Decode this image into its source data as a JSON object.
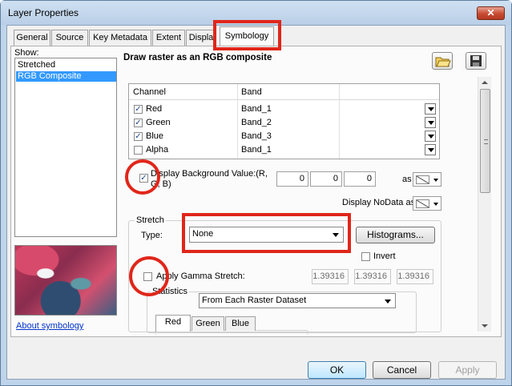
{
  "window": {
    "title": "Layer Properties",
    "close_glyph": "✕"
  },
  "tabs": [
    {
      "label": "General"
    },
    {
      "label": "Source"
    },
    {
      "label": "Key Metadata"
    },
    {
      "label": "Extent"
    },
    {
      "label": "Displa"
    },
    {
      "label": "Symbology"
    }
  ],
  "sidebar": {
    "show_label": "Show:",
    "items": [
      {
        "label": "Stretched"
      },
      {
        "label": "RGB Composite"
      }
    ],
    "selected_index": 1,
    "about_link": "About symbology"
  },
  "main": {
    "heading": "Draw raster as an RGB composite",
    "toolbar_icons": [
      "open-folder-icon",
      "save-icon"
    ],
    "channel_table": {
      "headers": [
        "Channel",
        "Band"
      ],
      "rows": [
        {
          "channel": "Red",
          "band": "Band_1",
          "checked": true
        },
        {
          "channel": "Green",
          "band": "Band_2",
          "checked": true
        },
        {
          "channel": "Blue",
          "band": "Band_3",
          "checked": true
        },
        {
          "channel": "Alpha",
          "band": "Band_1",
          "checked": false
        }
      ]
    },
    "background": {
      "label": "Display Background Value:(R, G, B)",
      "checked": true,
      "r": "0",
      "g": "0",
      "b": "0",
      "as_label": "as"
    },
    "nodata": {
      "label": "Display NoData as"
    },
    "stretch": {
      "group_label": "Stretch",
      "type_label": "Type:",
      "type_value": "None",
      "histograms_button": "Histograms...",
      "invert_label": "Invert",
      "invert_checked": false,
      "gamma_label": "Apply Gamma Stretch:",
      "gamma_checked": false,
      "gamma_values": [
        "1.39316",
        "1.39316",
        "1.39316"
      ]
    },
    "statistics": {
      "group_label": "Statistics",
      "source_value": "From Each Raster Dataset",
      "subtabs": [
        "Red",
        "Green",
        "Blue"
      ]
    }
  },
  "footer": {
    "ok": "OK",
    "cancel": "Cancel",
    "apply": "Apply"
  },
  "colors": {
    "highlight": "#e0261a",
    "selection": "#3399ff"
  }
}
